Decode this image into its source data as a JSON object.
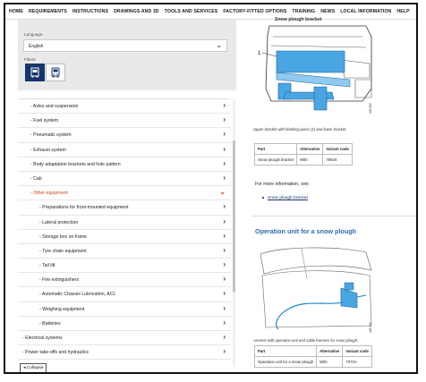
{
  "nav": {
    "items": [
      "HOME",
      "REQUIREMENTS",
      "INSTRUCTIONS",
      "DRAWINGS AND 3D",
      "TOOLS AND SERVICES",
      "FACTORY-FITTED OPTIONS",
      "TRAINING",
      "NEWS",
      "LOCAL INFORMATION",
      "HELP"
    ]
  },
  "filters": {
    "language_label": "Language",
    "language_value": "English",
    "filters_label": "Filters"
  },
  "tree": {
    "items": [
      {
        "label": "Axles and suspension",
        "level": "sub-top"
      },
      {
        "label": "Fuel system",
        "level": "sub-top"
      },
      {
        "label": "Pneumatic system",
        "level": "sub-top"
      },
      {
        "label": "Exhaust system",
        "level": "sub-top"
      },
      {
        "label": "Body adaptation brackets and hole pattern",
        "level": "sub-top"
      },
      {
        "label": "Cab",
        "level": "sub-top"
      },
      {
        "label": "Other equipment",
        "level": "open"
      },
      {
        "label": "Preparations for front-mounted equipment",
        "level": "child"
      },
      {
        "label": "Lateral protection",
        "level": "child"
      },
      {
        "label": "Storage box on frame",
        "level": "child"
      },
      {
        "label": "Tyre chain equipment",
        "level": "child"
      },
      {
        "label": "Tail lift",
        "level": "child"
      },
      {
        "label": "Fire extinguishers",
        "level": "child"
      },
      {
        "label": "Automatic Chassis Lubrication, ACL",
        "level": "child"
      },
      {
        "label": "Weighing equipment",
        "level": "child"
      },
      {
        "label": "Batteries",
        "level": "child"
      },
      {
        "label": "Electrical systems",
        "level": "root"
      },
      {
        "label": "Power take-offs and hydraulics",
        "level": "root"
      }
    ],
    "collapse_label": "Collapse"
  },
  "content": {
    "section1_title_clip": "Snow plough bracket",
    "figure1_callout": "1",
    "figure1_code": "448 600",
    "caption1": "Upper bracket with blanking piece (1) and lower bracket.",
    "table1": {
      "headers": [
        "Part",
        "Alternative",
        "Variant code"
      ],
      "rows": [
        [
          "Snow plough bracket",
          "With",
          "76634"
        ]
      ]
    },
    "more_info": "For more information, see:",
    "more_link": "Snow plough bracket",
    "section2_title": "Operation unit for a snow plough",
    "figure2_code": "448 599",
    "caption2": "Armrest with operation unit and cable harness for snow plough.",
    "table2": {
      "headers": [
        "Part",
        "Alternative",
        "Variant code"
      ],
      "rows": [
        [
          "Operation unit for a snow plough",
          "With",
          "7072A"
        ]
      ]
    }
  },
  "colors": {
    "accent_blue": "#15366a",
    "highlight_blue": "#1e88c9",
    "open_orange": "#d2431e",
    "panel_gray": "#e9e9e9"
  }
}
